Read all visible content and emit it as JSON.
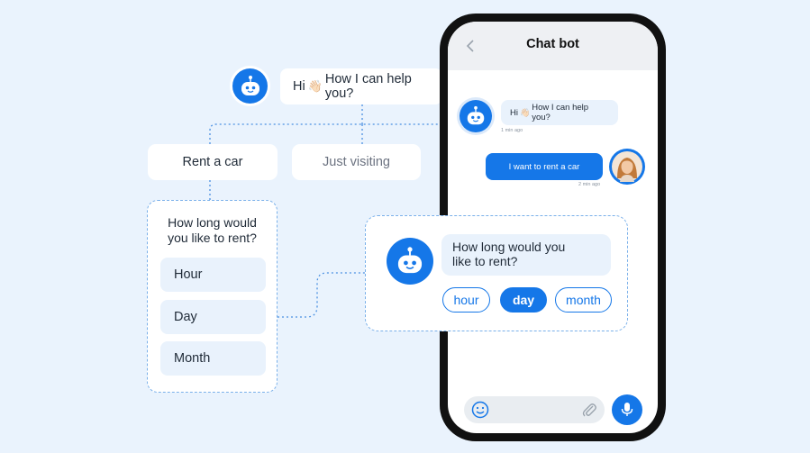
{
  "flow": {
    "greeting": {
      "wave": "👋🏻",
      "text": "How I can help you?",
      "prefix": "Hi"
    },
    "choices": {
      "rent": "Rent a car",
      "visit": "Just visiting"
    },
    "duration_question": [
      "How long would",
      "you like to rent?"
    ],
    "duration_options": [
      "Hour",
      "Day",
      "Month"
    ]
  },
  "phone": {
    "title": "Chat bot",
    "back_icon": "chevron-left-icon",
    "messages": [
      {
        "from": "bot",
        "prefix": "Hi",
        "wave": "👋🏻",
        "text": "How I can help you?",
        "time": "1 min ago"
      },
      {
        "from": "user",
        "text": "I want to rent a car",
        "time": "2 min ago"
      }
    ],
    "input": {
      "emoji_icon": "smile-icon",
      "attach_icon": "paperclip-icon",
      "mic_icon": "microphone-icon"
    }
  },
  "card": {
    "question": [
      "How long would you",
      "like to rent?"
    ],
    "options": [
      {
        "label": "hour",
        "selected": false
      },
      {
        "label": "day",
        "selected": true
      },
      {
        "label": "month",
        "selected": false
      }
    ]
  },
  "colors": {
    "accent": "#1577e8",
    "background": "#eaf3fd",
    "bubble": "#e9f2fc"
  }
}
